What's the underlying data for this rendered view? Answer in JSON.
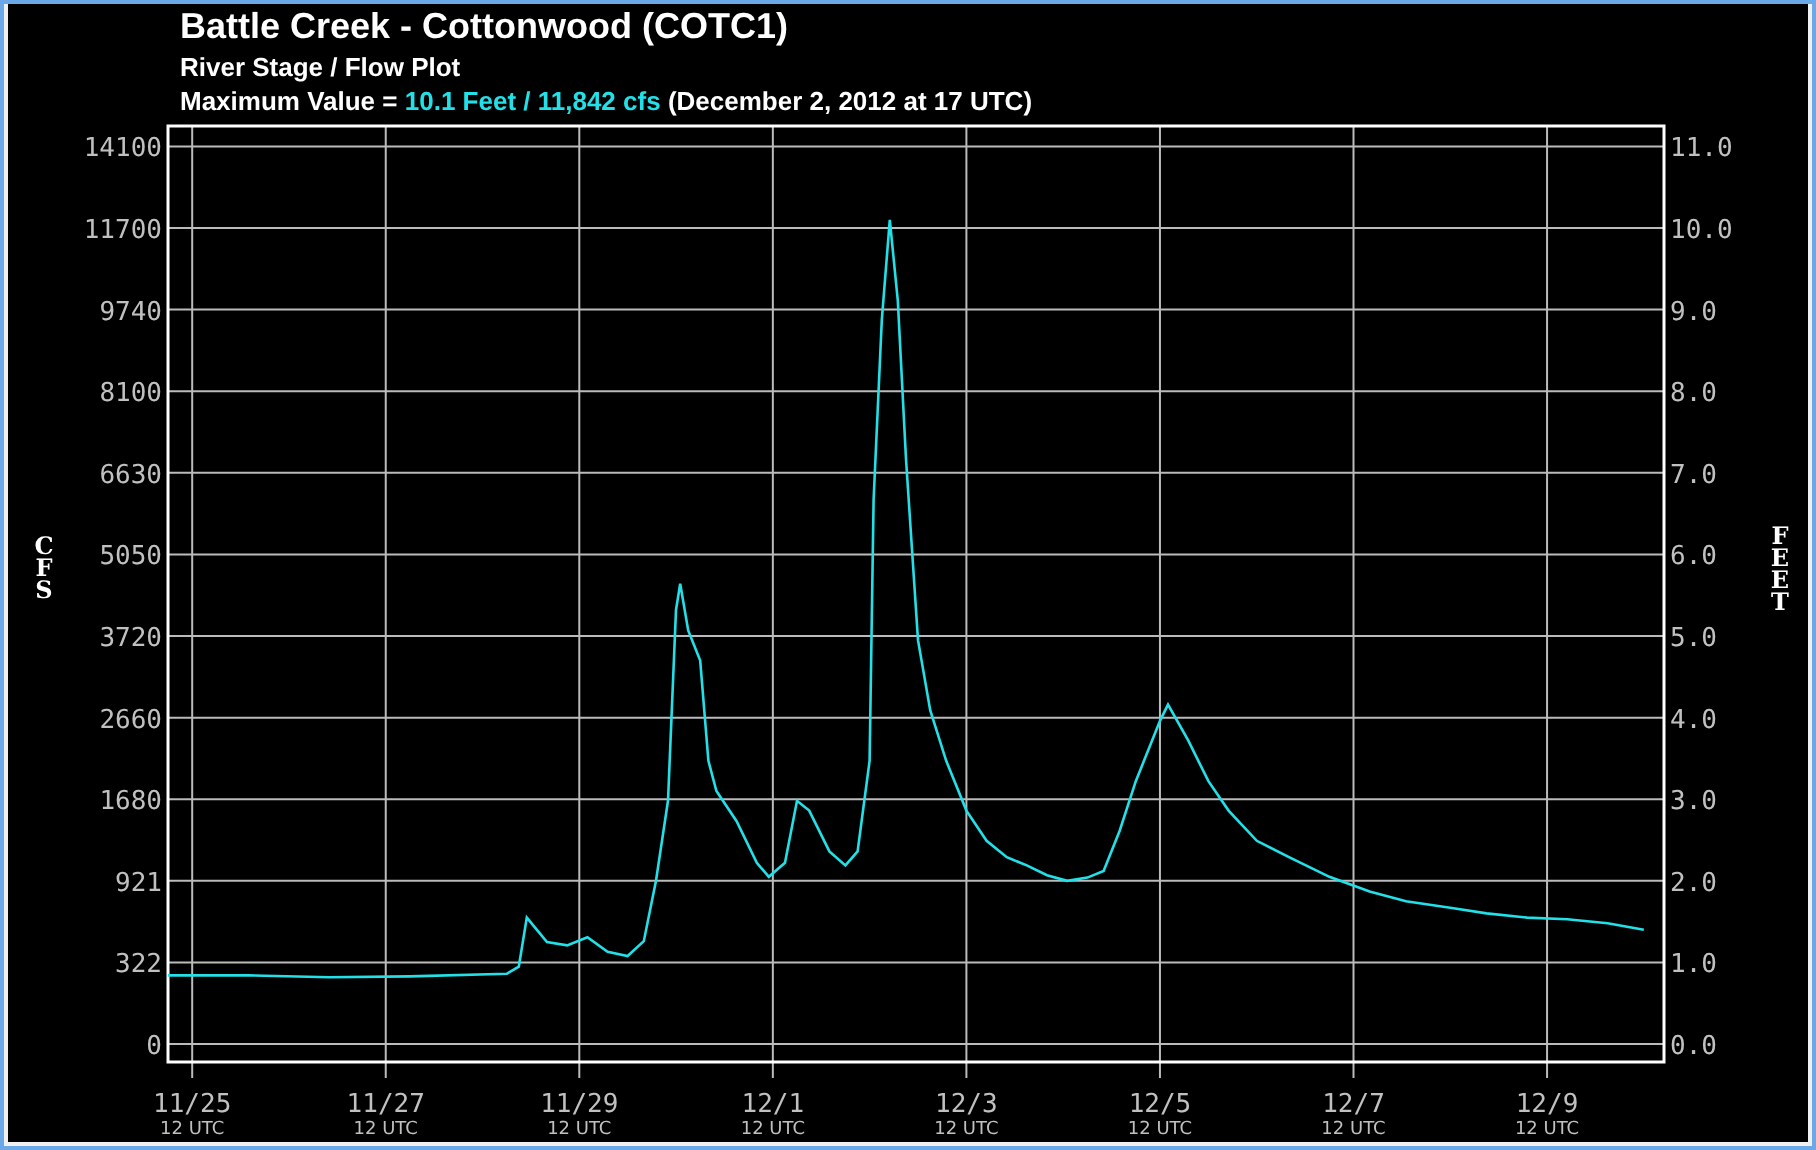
{
  "header": {
    "title": "Battle Creek - Cottonwood (COTC1)",
    "subtitle": "River Stage / Flow Plot",
    "max_label": "Maximum Value =",
    "max_value": "10.1 Feet / 11,842 cfs",
    "max_date": "(December 2, 2012 at 17 UTC)"
  },
  "chart": {
    "cfs_axis": {
      "title": "CFS",
      "labels": [
        "14100",
        "11700",
        "9740",
        "8100",
        "6630",
        "5050",
        "3720",
        "2660",
        "1680",
        "921",
        "322",
        "0"
      ]
    },
    "x_tick_sublabels": [
      "12 UTC",
      "12 UTC",
      "12 UTC",
      "12 UTC",
      "12 UTC",
      "12 UTC",
      "12 UTC",
      "12 UTC"
    ],
    "chart_data": {
      "type": "line",
      "ylabel": "FEET",
      "grid": true,
      "xlim": [
        "2012-11-25T06:00Z",
        "2012-12-10T17:00Z"
      ],
      "ylim": [
        -0.22,
        11.25
      ],
      "xticks": [
        {
          "value": "2012-11-25T12:00Z",
          "label": "11/25"
        },
        {
          "value": "2012-11-27T12:00Z",
          "label": "11/27"
        },
        {
          "value": "2012-11-29T12:00Z",
          "label": "11/29"
        },
        {
          "value": "2012-12-01T12:00Z",
          "label": "12/1"
        },
        {
          "value": "2012-12-03T12:00Z",
          "label": "12/3"
        },
        {
          "value": "2012-12-05T12:00Z",
          "label": "12/5"
        },
        {
          "value": "2012-12-07T12:00Z",
          "label": "12/7"
        },
        {
          "value": "2012-12-09T12:00Z",
          "label": "12/9"
        }
      ],
      "yticks": [
        {
          "value": 0,
          "label": "0.0"
        },
        {
          "value": 1,
          "label": "1.0"
        },
        {
          "value": 2,
          "label": "2.0"
        },
        {
          "value": 3,
          "label": "3.0"
        },
        {
          "value": 4,
          "label": "4.0"
        },
        {
          "value": 5,
          "label": "5.0"
        },
        {
          "value": 6,
          "label": "6.0"
        },
        {
          "value": 7,
          "label": "7.0"
        },
        {
          "value": 8,
          "label": "8.0"
        },
        {
          "value": 9,
          "label": "9.0"
        },
        {
          "value": 10,
          "label": "10.0"
        },
        {
          "value": 11,
          "label": "11.0"
        }
      ],
      "x": [
        "2012-11-25T06:00Z",
        "2012-11-26T02:00Z",
        "2012-11-26T22:00Z",
        "2012-11-27T18:00Z",
        "2012-11-28T18:00Z",
        "2012-11-28T21:00Z",
        "2012-11-28T23:00Z",
        "2012-11-29T04:00Z",
        "2012-11-29T09:00Z",
        "2012-11-29T14:00Z",
        "2012-11-29T19:00Z",
        "2012-11-30T00:00Z",
        "2012-11-30T04:00Z",
        "2012-11-30T07:00Z",
        "2012-11-30T10:00Z",
        "2012-11-30T12:00Z",
        "2012-11-30T13:00Z",
        "2012-11-30T15:00Z",
        "2012-11-30T18:00Z",
        "2012-11-30T20:00Z",
        "2012-11-30T22:00Z",
        "2012-12-01T03:00Z",
        "2012-12-01T08:00Z",
        "2012-12-01T11:00Z",
        "2012-12-01T15:00Z",
        "2012-12-01T18:00Z",
        "2012-12-01T21:00Z",
        "2012-12-02T02:00Z",
        "2012-12-02T06:00Z",
        "2012-12-02T09:00Z",
        "2012-12-02T12:00Z",
        "2012-12-02T13:00Z",
        "2012-12-02T15:00Z",
        "2012-12-02T17:00Z",
        "2012-12-02T19:00Z",
        "2012-12-02T21:00Z",
        "2012-12-03T00:00Z",
        "2012-12-03T03:00Z",
        "2012-12-03T07:00Z",
        "2012-12-03T12:00Z",
        "2012-12-03T17:00Z",
        "2012-12-03T22:00Z",
        "2012-12-04T03:00Z",
        "2012-12-04T08:00Z",
        "2012-12-04T13:00Z",
        "2012-12-04T18:00Z",
        "2012-12-04T22:00Z",
        "2012-12-05T02:00Z",
        "2012-12-05T06:00Z",
        "2012-12-05T12:00Z",
        "2012-12-05T14:00Z",
        "2012-12-05T19:00Z",
        "2012-12-06T00:00Z",
        "2012-12-06T05:00Z",
        "2012-12-06T12:00Z",
        "2012-12-06T20:00Z",
        "2012-12-07T06:00Z",
        "2012-12-07T16:00Z",
        "2012-12-08T01:00Z",
        "2012-12-08T12:00Z",
        "2012-12-08T21:00Z",
        "2012-12-09T07:00Z",
        "2012-12-09T17:00Z",
        "2012-12-10T03:00Z",
        "2012-12-10T12:00Z"
      ],
      "series": [
        {
          "color": "#22e0e8",
          "values": [
            0.84,
            0.84,
            0.82,
            0.83,
            0.86,
            0.95,
            1.55,
            1.25,
            1.21,
            1.31,
            1.13,
            1.08,
            1.26,
            2.0,
            2.98,
            5.32,
            5.64,
            5.07,
            4.7,
            3.47,
            3.1,
            2.73,
            2.22,
            2.05,
            2.22,
            2.98,
            2.86,
            2.36,
            2.19,
            2.36,
            3.47,
            6.67,
            8.87,
            10.1,
            9.11,
            7.17,
            4.95,
            4.09,
            3.47,
            2.86,
            2.49,
            2.29,
            2.19,
            2.07,
            2.0,
            2.04,
            2.12,
            2.61,
            3.22,
            3.96,
            4.16,
            3.72,
            3.22,
            2.86,
            2.49,
            2.29,
            2.05,
            1.87,
            1.75,
            1.67,
            1.6,
            1.55,
            1.53,
            1.48,
            1.4
          ]
        }
      ]
    }
  }
}
